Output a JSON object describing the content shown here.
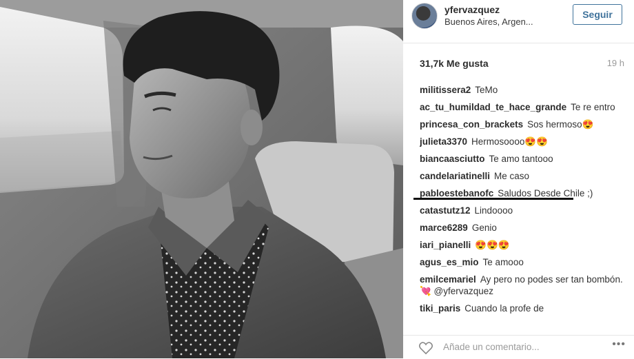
{
  "post": {
    "username": "yfervazquez",
    "location": "Buenos Aires, Argen...",
    "follow_label": "Seguir",
    "likes": "31,7k Me gusta",
    "time": "19 h"
  },
  "comments": [
    {
      "user": "militissera2",
      "text": "TeMo"
    },
    {
      "user": "ac_tu_humildad_te_hace_grande",
      "text": "Te re entro"
    },
    {
      "user": "princesa_con_brackets",
      "text": "Sos hermoso",
      "emoji": "😍"
    },
    {
      "user": "julieta3370",
      "text": "Hermosoooo",
      "emoji": "😍😍"
    },
    {
      "user": "biancaasciutto",
      "text": "Te amo tantooo"
    },
    {
      "user": "candelariatinelli",
      "text": "Me caso"
    },
    {
      "user": "pabloestebanofc",
      "text": "Saludos Desde Chile ;)"
    },
    {
      "user": "catastutz12",
      "text": "Lindoooo"
    },
    {
      "user": "marce6289",
      "text": "Genio"
    },
    {
      "user": "iari_pianelli",
      "text": "",
      "emoji": "😍😍😍"
    },
    {
      "user": "agus_es_mio",
      "text": "Te amooo"
    },
    {
      "user": "emilcemariel",
      "text": "Ay pero no podes ser tan bombón. 💘 @yfervazquez"
    },
    {
      "user": "tiki_paris",
      "text": "Cuando la profe de"
    }
  ],
  "add_comment": {
    "placeholder": "Añade un comentario..."
  },
  "icons": {
    "like": "heart-icon",
    "options": "more-options-icon"
  }
}
